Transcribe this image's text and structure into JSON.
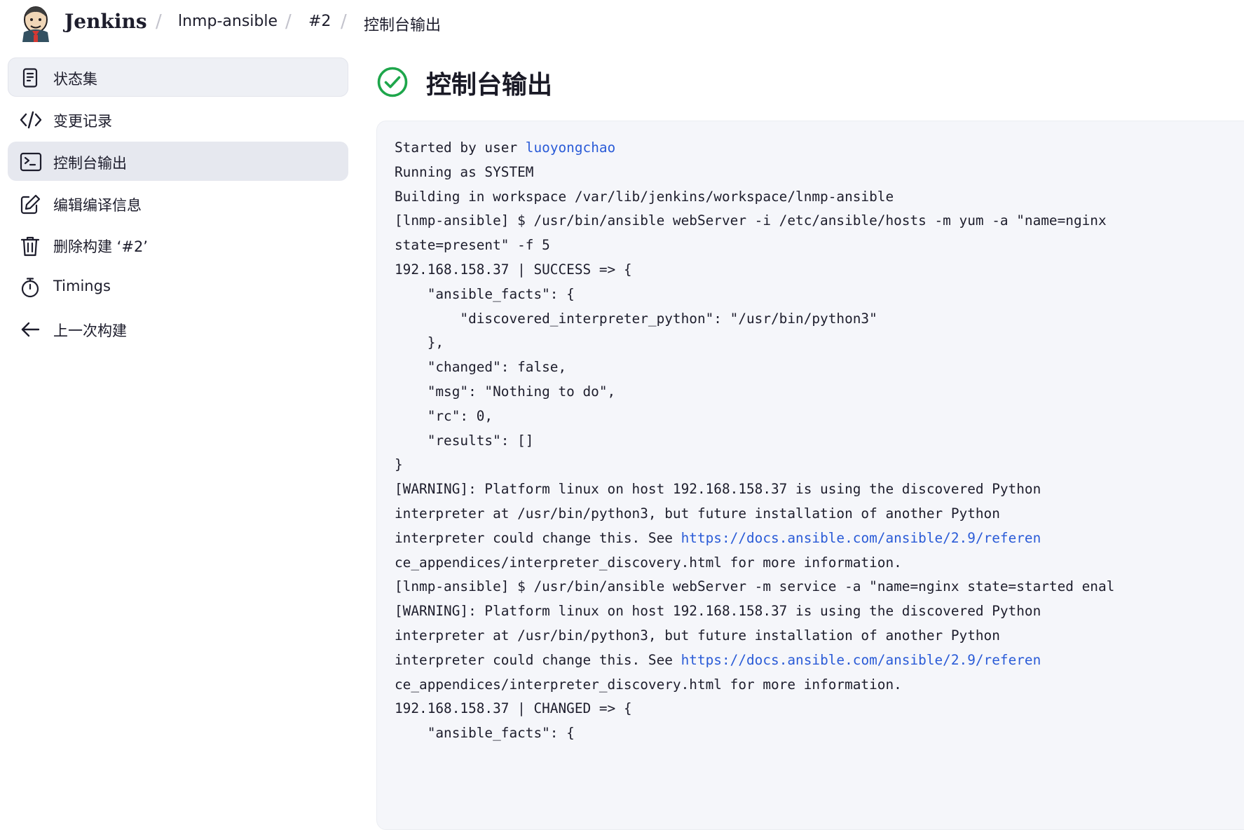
{
  "header": {
    "brand": "Jenkins",
    "breadcrumbs": [
      "lnmp-ansible",
      "#2",
      "控制台输出"
    ],
    "separator": "/"
  },
  "sidebar": {
    "items": [
      {
        "label": "状态集",
        "icon": "document-icon"
      },
      {
        "label": "变更记录",
        "icon": "code-icon"
      },
      {
        "label": "控制台输出",
        "icon": "terminal-icon"
      },
      {
        "label": "编辑编译信息",
        "icon": "edit-icon"
      },
      {
        "label": "删除构建 ‘#2’",
        "icon": "trash-icon"
      },
      {
        "label": "Timings",
        "icon": "stopwatch-icon"
      },
      {
        "label": "上一次构建",
        "icon": "arrow-left-icon"
      }
    ]
  },
  "main": {
    "title": "控制台输出",
    "status_icon": "success-check-icon"
  },
  "console": {
    "lines": [
      {
        "parts": [
          {
            "t": "Started by user "
          },
          {
            "t": "luoyongchao",
            "link": true
          }
        ]
      },
      {
        "parts": [
          {
            "t": "Running as SYSTEM"
          }
        ]
      },
      {
        "parts": [
          {
            "t": "Building in workspace /var/lib/jenkins/workspace/lnmp-ansible"
          }
        ]
      },
      {
        "parts": [
          {
            "t": "[lnmp-ansible] $ /usr/bin/ansible webServer -i /etc/ansible/hosts -m yum -a \"name=nginx"
          }
        ]
      },
      {
        "parts": [
          {
            "t": "state=present\" -f 5"
          }
        ]
      },
      {
        "parts": [
          {
            "t": "192.168.158.37 | SUCCESS => {"
          }
        ]
      },
      {
        "parts": [
          {
            "t": "    \"ansible_facts\": {"
          }
        ]
      },
      {
        "parts": [
          {
            "t": "        \"discovered_interpreter_python\": \"/usr/bin/python3\""
          }
        ]
      },
      {
        "parts": [
          {
            "t": "    },"
          }
        ]
      },
      {
        "parts": [
          {
            "t": "    \"changed\": false,"
          }
        ]
      },
      {
        "parts": [
          {
            "t": "    \"msg\": \"Nothing to do\","
          }
        ]
      },
      {
        "parts": [
          {
            "t": "    \"rc\": 0,"
          }
        ]
      },
      {
        "parts": [
          {
            "t": "    \"results\": []"
          }
        ]
      },
      {
        "parts": [
          {
            "t": "}"
          }
        ]
      },
      {
        "parts": [
          {
            "t": "[WARNING]: Platform linux on host 192.168.158.37 is using the discovered Python"
          }
        ]
      },
      {
        "parts": [
          {
            "t": "interpreter at /usr/bin/python3, but future installation of another Python"
          }
        ]
      },
      {
        "parts": [
          {
            "t": "interpreter could change this. See "
          },
          {
            "t": "https://docs.ansible.com/ansible/2.9/referen",
            "link": true
          }
        ]
      },
      {
        "parts": [
          {
            "t": "ce_appendices/interpreter_discovery.html for more information."
          }
        ]
      },
      {
        "parts": [
          {
            "t": "[lnmp-ansible] $ /usr/bin/ansible webServer -m service -a \"name=nginx state=started enal"
          }
        ]
      },
      {
        "parts": [
          {
            "t": "[WARNING]: Platform linux on host 192.168.158.37 is using the discovered Python"
          }
        ]
      },
      {
        "parts": [
          {
            "t": "interpreter at /usr/bin/python3, but future installation of another Python"
          }
        ]
      },
      {
        "parts": [
          {
            "t": "interpreter could change this. See "
          },
          {
            "t": "https://docs.ansible.com/ansible/2.9/referen",
            "link": true
          }
        ]
      },
      {
        "parts": [
          {
            "t": "ce_appendices/interpreter_discovery.html for more information."
          }
        ]
      },
      {
        "parts": [
          {
            "t": "192.168.158.37 | CHANGED => {"
          }
        ]
      },
      {
        "parts": [
          {
            "t": "    \"ansible_facts\": {"
          }
        ]
      }
    ]
  },
  "colors": {
    "success": "#1ea64b",
    "link": "#2a5bd7",
    "console_bg": "#f5f6fa",
    "active_item_bg": "#e6e8ef"
  }
}
